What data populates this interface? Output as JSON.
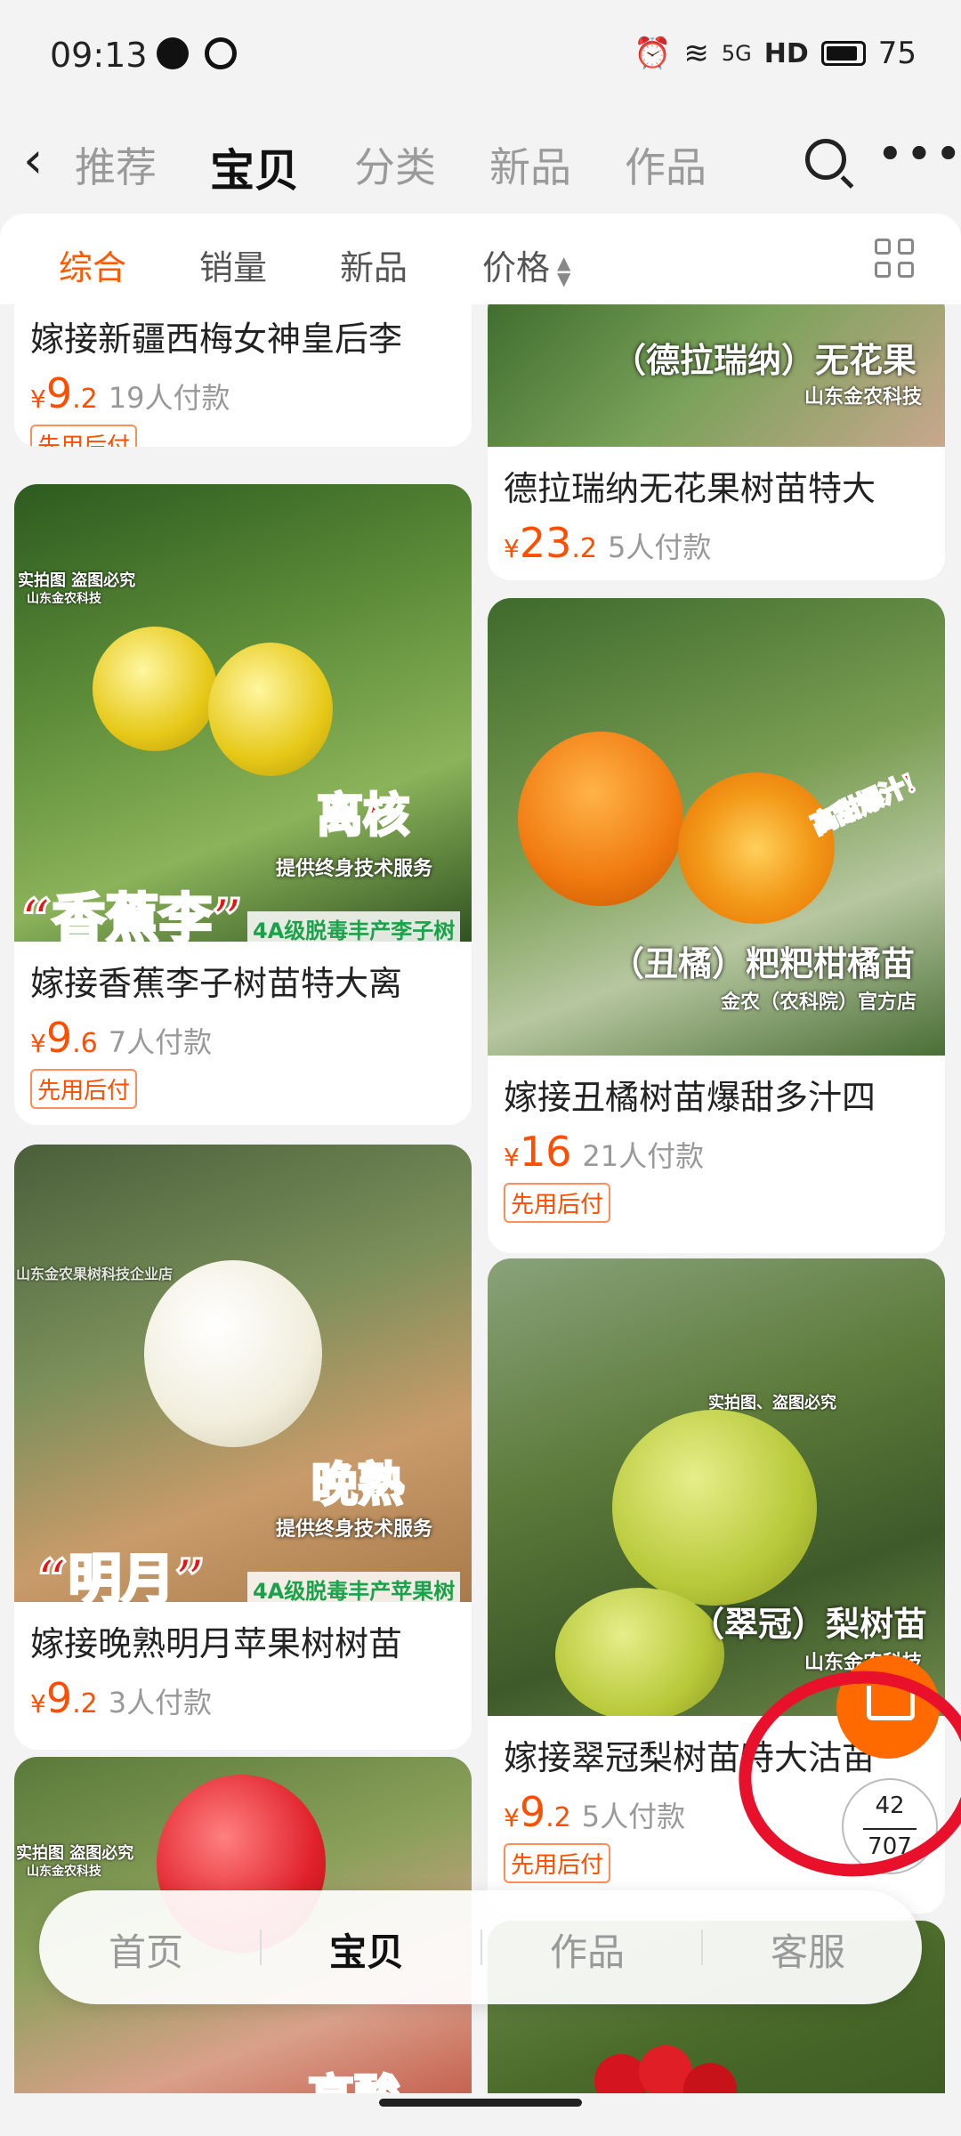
{
  "status_bar": {
    "time": "09:13",
    "signal": "5G",
    "hd": "HD",
    "battery": "75"
  },
  "nav": {
    "tabs": [
      "推荐",
      "宝贝",
      "分类",
      "新品",
      "作品"
    ],
    "active": "宝贝"
  },
  "filters": {
    "items": [
      "综合",
      "销量",
      "新品",
      "价格"
    ],
    "active": "综合"
  },
  "products": [
    {
      "title": "嫁接新疆西梅女神皇后李",
      "price_int": "9",
      "price_dec": ".2",
      "sold": "19人付款",
      "badge": "先用后付"
    },
    {
      "title": "德拉瑞纳无花果树苗特大",
      "price_int": "23",
      "price_dec": ".2",
      "sold": "5人付款",
      "image_text": "（德拉瑞纳）无花果",
      "image_sub": "山东金农科技"
    },
    {
      "title": "嫁接香蕉李子树苗特大离",
      "price_int": "9",
      "price_dec": ".6",
      "sold": "7人付款",
      "badge": "先用后付",
      "image_big": "“香蕉李”",
      "image_side": "离核",
      "image_service": "提供终身技术服务",
      "image_grade": "4A级脱毒丰产李子树",
      "image_watermark": "实拍图 盗图必究",
      "image_sub": "山东金农科技"
    },
    {
      "title": "嫁接丑橘树苗爆甜多汁四",
      "price_int": "16",
      "price_dec": "",
      "sold": "21人付款",
      "badge": "先用后付",
      "image_text": "（丑橘）粑粑柑橘苗",
      "image_sub": "金农（农科院）官方店",
      "image_tag": "高甜爆汁!"
    },
    {
      "title": "嫁接晚熟明月苹果树树苗",
      "price_int": "9",
      "price_dec": ".2",
      "sold": "3人付款",
      "image_big": "“明月”",
      "image_side": "晚熟",
      "image_service": "提供终身技术服务",
      "image_grade": "4A级脱毒丰产苹果树",
      "image_watermark": "山东金农果树科技企业店"
    },
    {
      "title": "嫁接翠冠梨树苗特大沽苗",
      "price_int": "9",
      "price_dec": ".2",
      "sold": "5人付款",
      "badge": "先用后付",
      "image_text": "（翠冠）梨树苗",
      "image_sub": "山东金农科技",
      "image_watermark": "实拍图、盗图必究"
    },
    {
      "image_watermark": "实拍图 盗图必究",
      "image_sub": "山东金农科技",
      "image_big": "高酸"
    }
  ],
  "currency": "¥",
  "bottom_tabs": [
    "首页",
    "宝贝",
    "作品",
    "客服"
  ],
  "bottom_active": "宝贝",
  "pager": {
    "current": "42",
    "total": "707"
  }
}
